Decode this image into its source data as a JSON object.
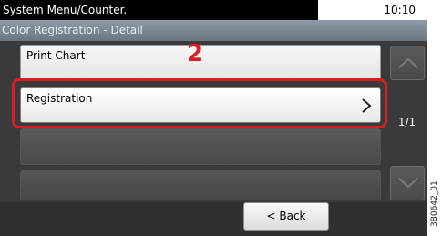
{
  "header": {
    "menu_path": "System Menu/Counter.",
    "clock": "10:10"
  },
  "screen_title": "Color Registration - Detail",
  "list": {
    "items": [
      {
        "label": "Print Chart"
      },
      {
        "label": "Registration"
      }
    ]
  },
  "annotation": {
    "step_number": "2"
  },
  "pagination": {
    "indicator": "1/1"
  },
  "footer": {
    "back_label": "< Back"
  },
  "figure_code": "3B0642_01",
  "colors": {
    "highlight": "#d61f26"
  }
}
